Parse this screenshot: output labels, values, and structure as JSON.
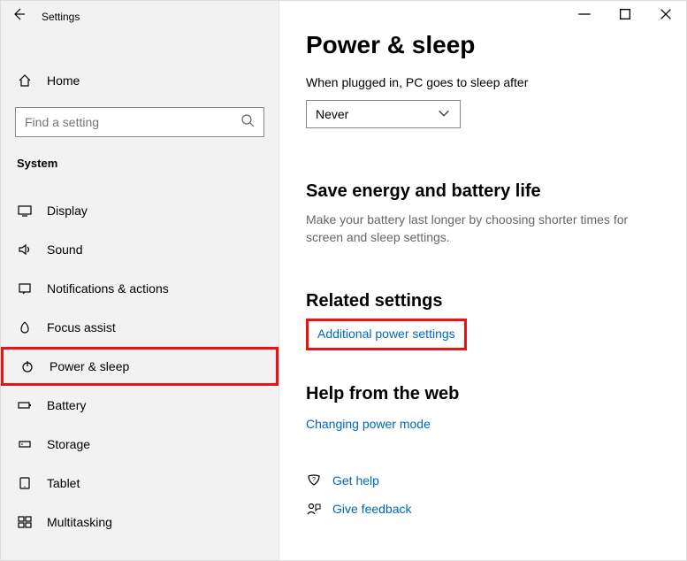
{
  "window": {
    "title": "Settings"
  },
  "sidebar": {
    "home": "Home",
    "search_placeholder": "Find a setting",
    "section": "System",
    "items": [
      {
        "label": "Display"
      },
      {
        "label": "Sound"
      },
      {
        "label": "Notifications & actions"
      },
      {
        "label": "Focus assist"
      },
      {
        "label": "Power & sleep"
      },
      {
        "label": "Battery"
      },
      {
        "label": "Storage"
      },
      {
        "label": "Tablet"
      },
      {
        "label": "Multitasking"
      }
    ]
  },
  "main": {
    "title": "Power & sleep",
    "plugged_caption": "When plugged in, PC goes to sleep after",
    "sleep_value": "Never",
    "energy_heading": "Save energy and battery life",
    "energy_desc": "Make your battery last longer by choosing shorter times for screen and sleep settings.",
    "related_heading": "Related settings",
    "related_link": "Additional power settings",
    "help_heading": "Help from the web",
    "help_link": "Changing power mode",
    "get_help": "Get help",
    "give_feedback": "Give feedback"
  }
}
